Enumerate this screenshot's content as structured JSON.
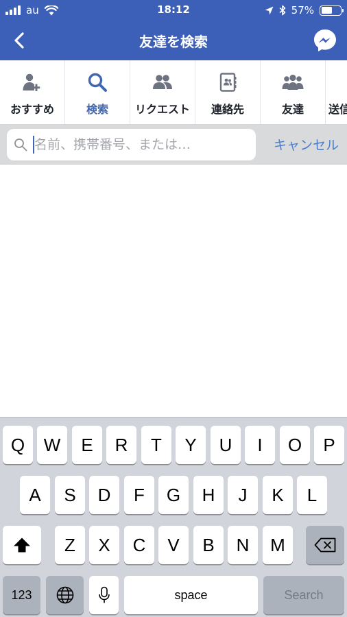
{
  "status": {
    "carrier": "au",
    "time": "18:12",
    "battery": "57%",
    "battery_level": 0.57
  },
  "header": {
    "title": "友達を検索"
  },
  "tabs": [
    {
      "label": "おすすめ",
      "icon": "add-friend-icon",
      "active": false
    },
    {
      "label": "検索",
      "icon": "search-icon",
      "active": true
    },
    {
      "label": "リクエスト",
      "icon": "friend-requests-icon",
      "active": false
    },
    {
      "label": "連絡先",
      "icon": "contacts-icon",
      "active": false
    },
    {
      "label": "友達",
      "icon": "friends-icon",
      "active": false
    },
    {
      "label": "送信",
      "icon": "sent-icon",
      "active": false
    }
  ],
  "search": {
    "placeholder": "名前、携帯番号、または…",
    "value": "",
    "cancel_label": "キャンセル"
  },
  "keyboard": {
    "row1": [
      "Q",
      "W",
      "E",
      "R",
      "T",
      "Y",
      "U",
      "I",
      "O",
      "P"
    ],
    "row2": [
      "A",
      "S",
      "D",
      "F",
      "G",
      "H",
      "J",
      "K",
      "L"
    ],
    "row3": [
      "Z",
      "X",
      "C",
      "V",
      "B",
      "N",
      "M"
    ],
    "numbers_label": "123",
    "space_label": "space",
    "search_label": "Search"
  },
  "colors": {
    "brand": "#3c5fb8",
    "active_tab": "#4267b2",
    "cancel": "#4a7cd0"
  }
}
